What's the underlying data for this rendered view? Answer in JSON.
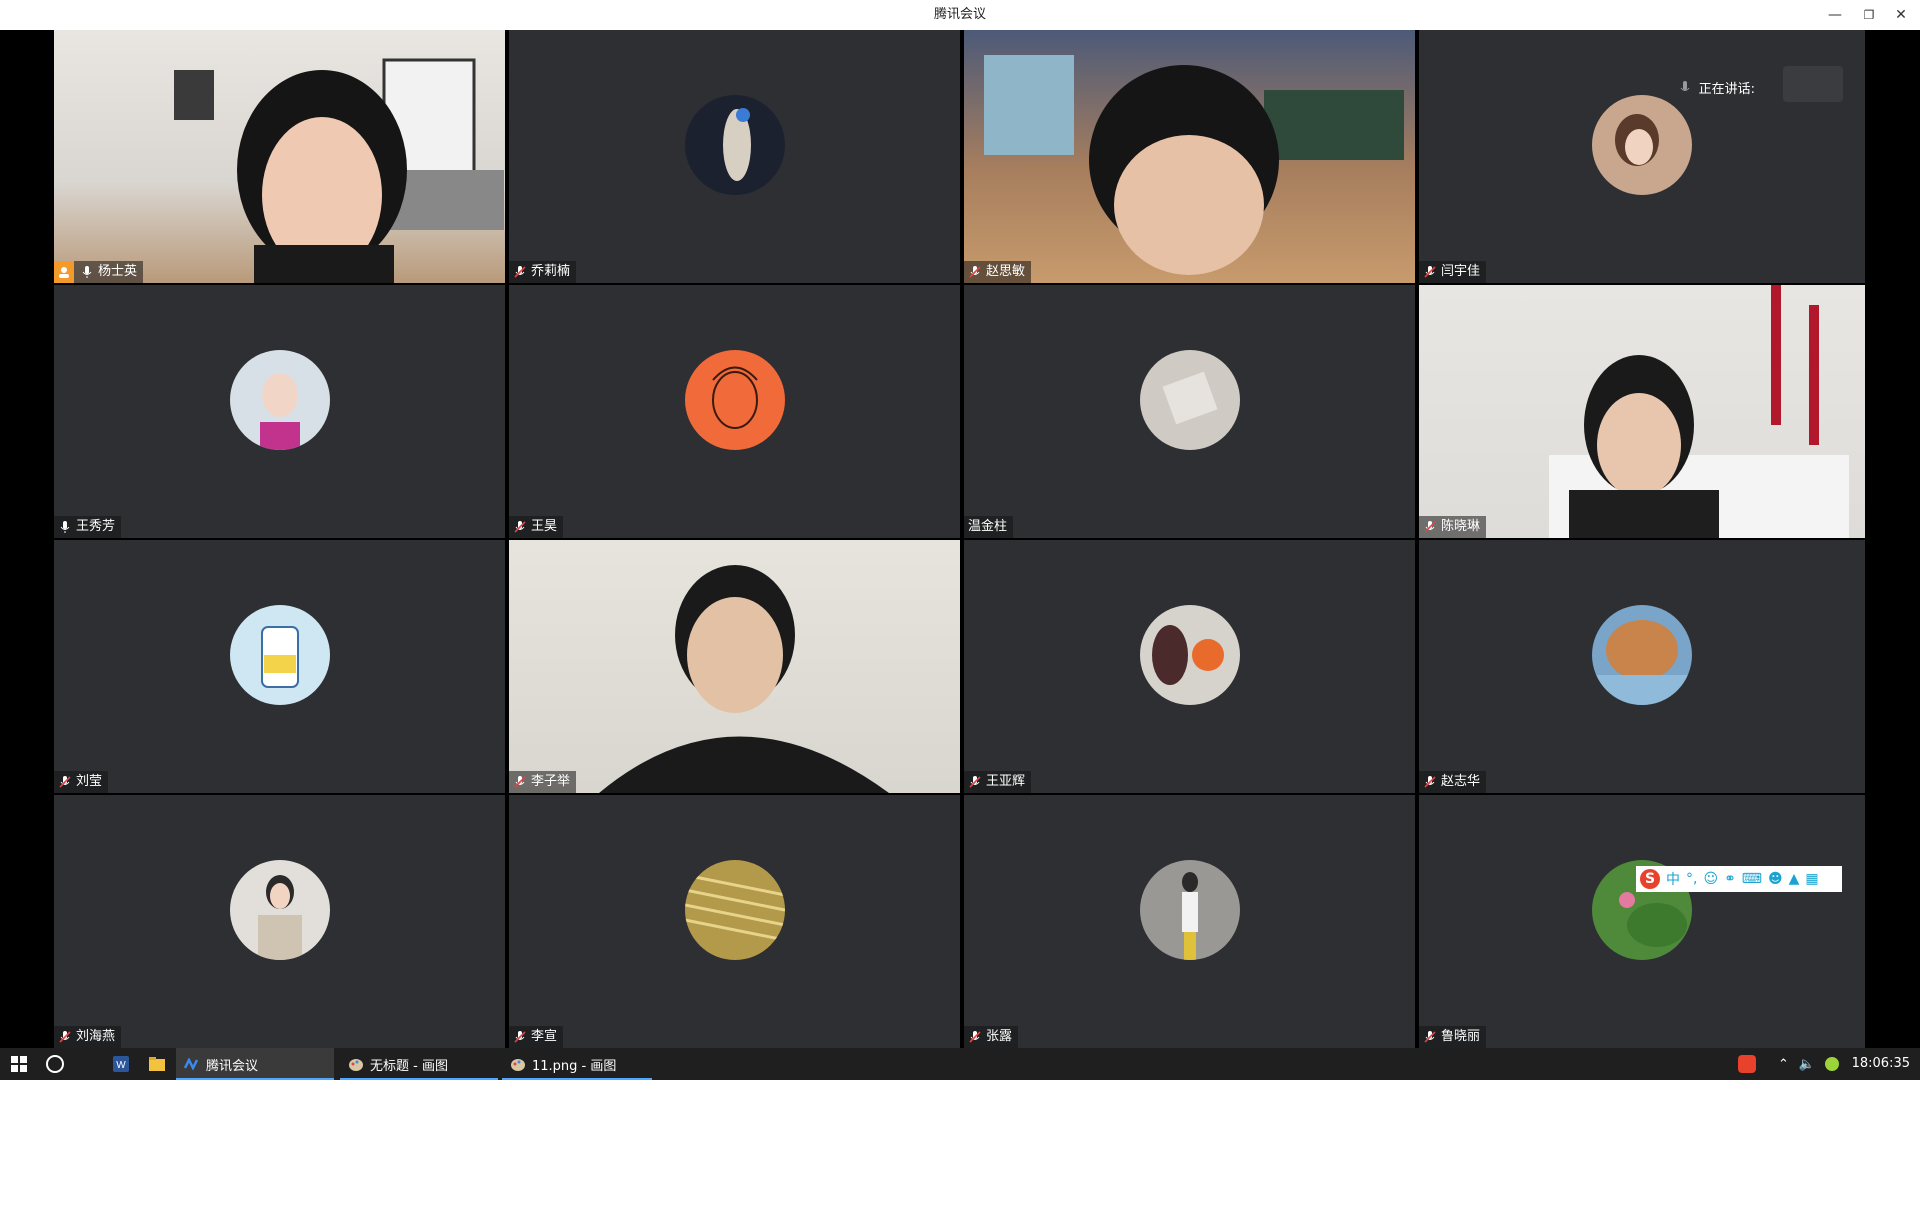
{
  "window": {
    "title": "腾讯会议"
  },
  "meeting": {
    "speaking_label": "正在讲话:",
    "participants": [
      {
        "name": "杨士英",
        "host": true
      },
      {
        "name": "乔莉楠"
      },
      {
        "name": "赵思敏"
      },
      {
        "name": "闫宇佳"
      },
      {
        "name": "王秀芳"
      },
      {
        "name": "王昊"
      },
      {
        "name": "温金柱"
      },
      {
        "name": "陈晓琳"
      },
      {
        "name": "刘莹"
      },
      {
        "name": "李子举"
      },
      {
        "name": "王亚辉"
      },
      {
        "name": "赵志华"
      },
      {
        "name": "刘海燕"
      },
      {
        "name": "李宣"
      },
      {
        "name": "张露"
      },
      {
        "name": "鲁晓丽"
      }
    ]
  },
  "ime": {
    "mode": "中"
  },
  "taskbar": {
    "items": [
      {
        "label": "腾讯会议"
      },
      {
        "label": "无标题 - 画图"
      },
      {
        "label": "11.png - 画图"
      }
    ],
    "time": "18:06:35"
  },
  "colors": {
    "tile_bg": "#2d2f33",
    "host_badge": "#f39a2b",
    "stage_bg": "#000000"
  }
}
